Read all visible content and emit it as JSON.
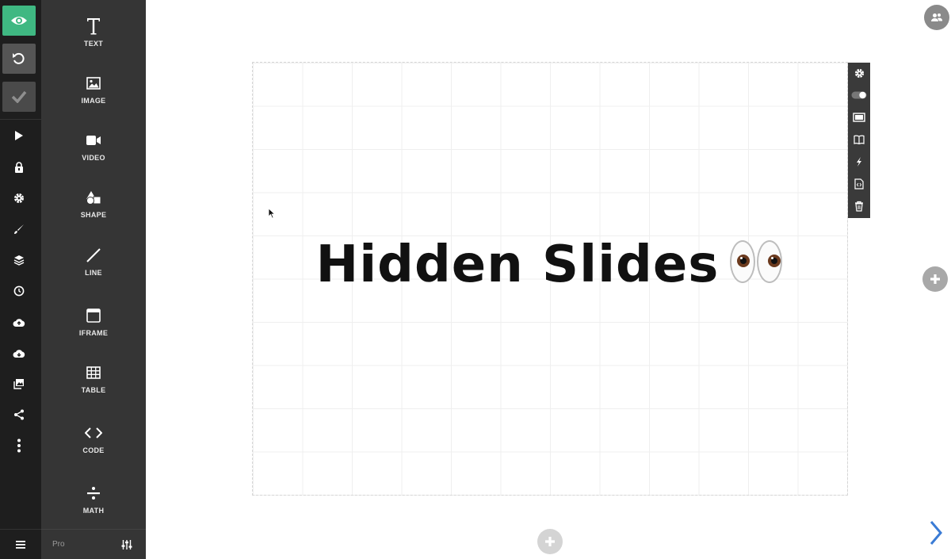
{
  "elements": {
    "items": [
      {
        "label": "TEXT",
        "icon": "text-icon"
      },
      {
        "label": "IMAGE",
        "icon": "image-icon"
      },
      {
        "label": "VIDEO",
        "icon": "video-icon"
      },
      {
        "label": "SHAPE",
        "icon": "shape-icon"
      },
      {
        "label": "LINE",
        "icon": "line-icon"
      },
      {
        "label": "IFRAME",
        "icon": "iframe-icon"
      },
      {
        "label": "TABLE",
        "icon": "table-icon"
      },
      {
        "label": "CODE",
        "icon": "code-icon"
      },
      {
        "label": "MATH",
        "icon": "math-icon"
      }
    ],
    "footer_label": "Pro"
  },
  "slide": {
    "title": "Hidden Slides"
  },
  "colors": {
    "preview_active": "#3fb882",
    "toolbar_bg": "#1e1e1e",
    "panel_bg": "#353535",
    "next_arrow": "#3a7bd5"
  }
}
